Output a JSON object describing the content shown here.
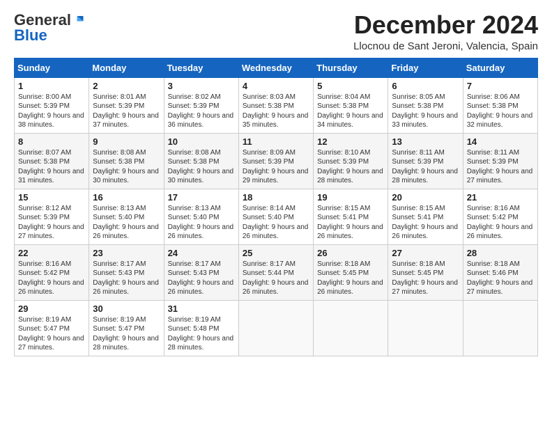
{
  "logo": {
    "general": "General",
    "blue": "Blue"
  },
  "header": {
    "month": "December 2024",
    "location": "Llocnou de Sant Jeroni, Valencia, Spain"
  },
  "weekdays": [
    "Sunday",
    "Monday",
    "Tuesday",
    "Wednesday",
    "Thursday",
    "Friday",
    "Saturday"
  ],
  "weeks": [
    [
      {
        "day": "1",
        "sunrise": "8:00 AM",
        "sunset": "5:39 PM",
        "daylight": "9 hours and 38 minutes."
      },
      {
        "day": "2",
        "sunrise": "8:01 AM",
        "sunset": "5:39 PM",
        "daylight": "9 hours and 37 minutes."
      },
      {
        "day": "3",
        "sunrise": "8:02 AM",
        "sunset": "5:39 PM",
        "daylight": "9 hours and 36 minutes."
      },
      {
        "day": "4",
        "sunrise": "8:03 AM",
        "sunset": "5:38 PM",
        "daylight": "9 hours and 35 minutes."
      },
      {
        "day": "5",
        "sunrise": "8:04 AM",
        "sunset": "5:38 PM",
        "daylight": "9 hours and 34 minutes."
      },
      {
        "day": "6",
        "sunrise": "8:05 AM",
        "sunset": "5:38 PM",
        "daylight": "9 hours and 33 minutes."
      },
      {
        "day": "7",
        "sunrise": "8:06 AM",
        "sunset": "5:38 PM",
        "daylight": "9 hours and 32 minutes."
      }
    ],
    [
      {
        "day": "8",
        "sunrise": "8:07 AM",
        "sunset": "5:38 PM",
        "daylight": "9 hours and 31 minutes."
      },
      {
        "day": "9",
        "sunrise": "8:08 AM",
        "sunset": "5:38 PM",
        "daylight": "9 hours and 30 minutes."
      },
      {
        "day": "10",
        "sunrise": "8:08 AM",
        "sunset": "5:38 PM",
        "daylight": "9 hours and 30 minutes."
      },
      {
        "day": "11",
        "sunrise": "8:09 AM",
        "sunset": "5:39 PM",
        "daylight": "9 hours and 29 minutes."
      },
      {
        "day": "12",
        "sunrise": "8:10 AM",
        "sunset": "5:39 PM",
        "daylight": "9 hours and 28 minutes."
      },
      {
        "day": "13",
        "sunrise": "8:11 AM",
        "sunset": "5:39 PM",
        "daylight": "9 hours and 28 minutes."
      },
      {
        "day": "14",
        "sunrise": "8:11 AM",
        "sunset": "5:39 PM",
        "daylight": "9 hours and 27 minutes."
      }
    ],
    [
      {
        "day": "15",
        "sunrise": "8:12 AM",
        "sunset": "5:39 PM",
        "daylight": "9 hours and 27 minutes."
      },
      {
        "day": "16",
        "sunrise": "8:13 AM",
        "sunset": "5:40 PM",
        "daylight": "9 hours and 26 minutes."
      },
      {
        "day": "17",
        "sunrise": "8:13 AM",
        "sunset": "5:40 PM",
        "daylight": "9 hours and 26 minutes."
      },
      {
        "day": "18",
        "sunrise": "8:14 AM",
        "sunset": "5:40 PM",
        "daylight": "9 hours and 26 minutes."
      },
      {
        "day": "19",
        "sunrise": "8:15 AM",
        "sunset": "5:41 PM",
        "daylight": "9 hours and 26 minutes."
      },
      {
        "day": "20",
        "sunrise": "8:15 AM",
        "sunset": "5:41 PM",
        "daylight": "9 hours and 26 minutes."
      },
      {
        "day": "21",
        "sunrise": "8:16 AM",
        "sunset": "5:42 PM",
        "daylight": "9 hours and 26 minutes."
      }
    ],
    [
      {
        "day": "22",
        "sunrise": "8:16 AM",
        "sunset": "5:42 PM",
        "daylight": "9 hours and 26 minutes."
      },
      {
        "day": "23",
        "sunrise": "8:17 AM",
        "sunset": "5:43 PM",
        "daylight": "9 hours and 26 minutes."
      },
      {
        "day": "24",
        "sunrise": "8:17 AM",
        "sunset": "5:43 PM",
        "daylight": "9 hours and 26 minutes."
      },
      {
        "day": "25",
        "sunrise": "8:17 AM",
        "sunset": "5:44 PM",
        "daylight": "9 hours and 26 minutes."
      },
      {
        "day": "26",
        "sunrise": "8:18 AM",
        "sunset": "5:45 PM",
        "daylight": "9 hours and 26 minutes."
      },
      {
        "day": "27",
        "sunrise": "8:18 AM",
        "sunset": "5:45 PM",
        "daylight": "9 hours and 27 minutes."
      },
      {
        "day": "28",
        "sunrise": "8:18 AM",
        "sunset": "5:46 PM",
        "daylight": "9 hours and 27 minutes."
      }
    ],
    [
      {
        "day": "29",
        "sunrise": "8:19 AM",
        "sunset": "5:47 PM",
        "daylight": "9 hours and 27 minutes."
      },
      {
        "day": "30",
        "sunrise": "8:19 AM",
        "sunset": "5:47 PM",
        "daylight": "9 hours and 28 minutes."
      },
      {
        "day": "31",
        "sunrise": "8:19 AM",
        "sunset": "5:48 PM",
        "daylight": "9 hours and 28 minutes."
      },
      null,
      null,
      null,
      null
    ]
  ],
  "labels": {
    "sunrise": "Sunrise:",
    "sunset": "Sunset:",
    "daylight": "Daylight:"
  }
}
